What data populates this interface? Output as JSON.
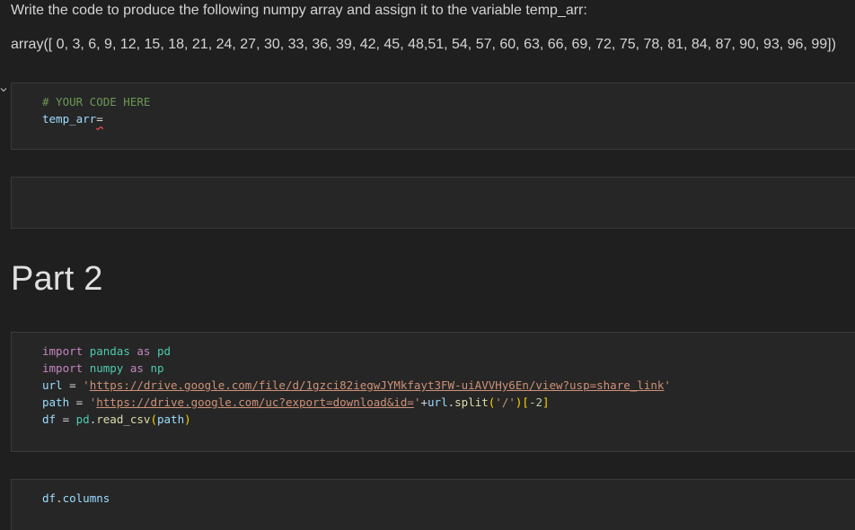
{
  "markdown": {
    "question": "Write the code to produce the following numpy array and assign it to the variable temp_arr:",
    "array_text": "array([ 0, 3, 6, 9, 12, 15, 18, 21, 24, 27, 30, 33, 36, 39, 42, 45, 48,51, 54, 57, 60, 63, 66, 69, 72, 75, 78, 81, 84, 87, 90, 93, 96, 99])"
  },
  "cell1": {
    "comment": "# YOUR CODE HERE",
    "var": "temp_arr",
    "op": "="
  },
  "heading": "Part 2",
  "cell3": {
    "line1": {
      "kw1": "import",
      "mod": "pandas",
      "kw2": "as",
      "alias": "pd"
    },
    "line2": {
      "kw1": "import",
      "mod": "numpy",
      "kw2": "as",
      "alias": "np"
    },
    "line3": {
      "var": "url",
      "op": "=",
      "q1": "'",
      "url": "https://drive.google.com/file/d/1gzci82iegwJYMkfayt3FW-uiAVVHy6En/view?usp=share_link",
      "q2": "'"
    },
    "line4": {
      "var": "path",
      "op": "=",
      "q1": "'",
      "url": "https://drive.google.com/uc?export=download&id=",
      "q2": "'",
      "plus": "+",
      "obj": "url",
      "dot": ".",
      "fn": "split",
      "lp": "(",
      "arg": "'/'",
      "rp": ")",
      "lb": "[",
      "idx": "-2",
      "rb": "]"
    },
    "line5": {
      "var": "df",
      "op": "=",
      "obj": "pd",
      "dot": ".",
      "fn": "read_csv",
      "lp": "(",
      "arg": "path",
      "rp": ")"
    }
  },
  "cell4": {
    "obj": "df",
    "dot": ".",
    "attr": "columns"
  },
  "icons": {
    "collapse": "chevron-down-icon"
  }
}
